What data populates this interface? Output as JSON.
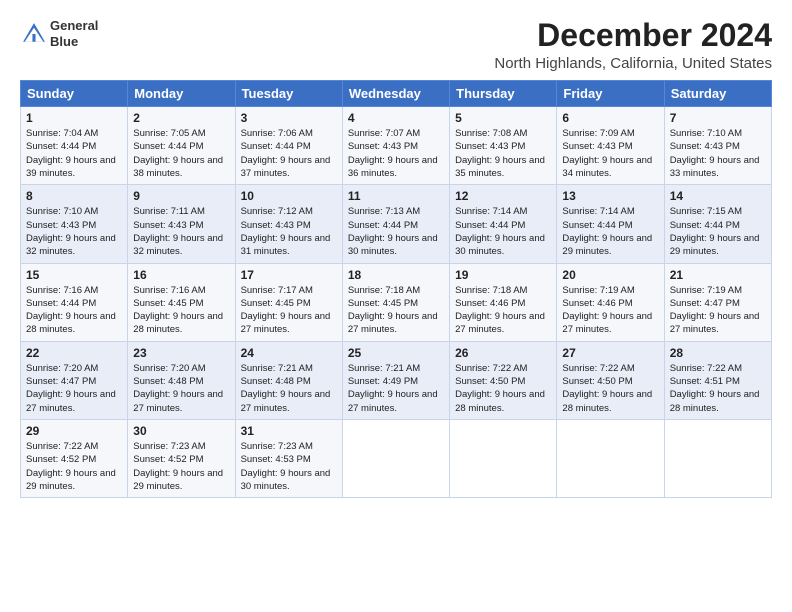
{
  "header": {
    "logo_line1": "General",
    "logo_line2": "Blue",
    "title": "December 2024",
    "location": "North Highlands, California, United States"
  },
  "days_of_week": [
    "Sunday",
    "Monday",
    "Tuesday",
    "Wednesday",
    "Thursday",
    "Friday",
    "Saturday"
  ],
  "weeks": [
    [
      {
        "day": "1",
        "sunrise": "Sunrise: 7:04 AM",
        "sunset": "Sunset: 4:44 PM",
        "daylight": "Daylight: 9 hours and 39 minutes."
      },
      {
        "day": "2",
        "sunrise": "Sunrise: 7:05 AM",
        "sunset": "Sunset: 4:44 PM",
        "daylight": "Daylight: 9 hours and 38 minutes."
      },
      {
        "day": "3",
        "sunrise": "Sunrise: 7:06 AM",
        "sunset": "Sunset: 4:44 PM",
        "daylight": "Daylight: 9 hours and 37 minutes."
      },
      {
        "day": "4",
        "sunrise": "Sunrise: 7:07 AM",
        "sunset": "Sunset: 4:43 PM",
        "daylight": "Daylight: 9 hours and 36 minutes."
      },
      {
        "day": "5",
        "sunrise": "Sunrise: 7:08 AM",
        "sunset": "Sunset: 4:43 PM",
        "daylight": "Daylight: 9 hours and 35 minutes."
      },
      {
        "day": "6",
        "sunrise": "Sunrise: 7:09 AM",
        "sunset": "Sunset: 4:43 PM",
        "daylight": "Daylight: 9 hours and 34 minutes."
      },
      {
        "day": "7",
        "sunrise": "Sunrise: 7:10 AM",
        "sunset": "Sunset: 4:43 PM",
        "daylight": "Daylight: 9 hours and 33 minutes."
      }
    ],
    [
      {
        "day": "8",
        "sunrise": "Sunrise: 7:10 AM",
        "sunset": "Sunset: 4:43 PM",
        "daylight": "Daylight: 9 hours and 32 minutes."
      },
      {
        "day": "9",
        "sunrise": "Sunrise: 7:11 AM",
        "sunset": "Sunset: 4:43 PM",
        "daylight": "Daylight: 9 hours and 32 minutes."
      },
      {
        "day": "10",
        "sunrise": "Sunrise: 7:12 AM",
        "sunset": "Sunset: 4:43 PM",
        "daylight": "Daylight: 9 hours and 31 minutes."
      },
      {
        "day": "11",
        "sunrise": "Sunrise: 7:13 AM",
        "sunset": "Sunset: 4:44 PM",
        "daylight": "Daylight: 9 hours and 30 minutes."
      },
      {
        "day": "12",
        "sunrise": "Sunrise: 7:14 AM",
        "sunset": "Sunset: 4:44 PM",
        "daylight": "Daylight: 9 hours and 30 minutes."
      },
      {
        "day": "13",
        "sunrise": "Sunrise: 7:14 AM",
        "sunset": "Sunset: 4:44 PM",
        "daylight": "Daylight: 9 hours and 29 minutes."
      },
      {
        "day": "14",
        "sunrise": "Sunrise: 7:15 AM",
        "sunset": "Sunset: 4:44 PM",
        "daylight": "Daylight: 9 hours and 29 minutes."
      }
    ],
    [
      {
        "day": "15",
        "sunrise": "Sunrise: 7:16 AM",
        "sunset": "Sunset: 4:44 PM",
        "daylight": "Daylight: 9 hours and 28 minutes."
      },
      {
        "day": "16",
        "sunrise": "Sunrise: 7:16 AM",
        "sunset": "Sunset: 4:45 PM",
        "daylight": "Daylight: 9 hours and 28 minutes."
      },
      {
        "day": "17",
        "sunrise": "Sunrise: 7:17 AM",
        "sunset": "Sunset: 4:45 PM",
        "daylight": "Daylight: 9 hours and 27 minutes."
      },
      {
        "day": "18",
        "sunrise": "Sunrise: 7:18 AM",
        "sunset": "Sunset: 4:45 PM",
        "daylight": "Daylight: 9 hours and 27 minutes."
      },
      {
        "day": "19",
        "sunrise": "Sunrise: 7:18 AM",
        "sunset": "Sunset: 4:46 PM",
        "daylight": "Daylight: 9 hours and 27 minutes."
      },
      {
        "day": "20",
        "sunrise": "Sunrise: 7:19 AM",
        "sunset": "Sunset: 4:46 PM",
        "daylight": "Daylight: 9 hours and 27 minutes."
      },
      {
        "day": "21",
        "sunrise": "Sunrise: 7:19 AM",
        "sunset": "Sunset: 4:47 PM",
        "daylight": "Daylight: 9 hours and 27 minutes."
      }
    ],
    [
      {
        "day": "22",
        "sunrise": "Sunrise: 7:20 AM",
        "sunset": "Sunset: 4:47 PM",
        "daylight": "Daylight: 9 hours and 27 minutes."
      },
      {
        "day": "23",
        "sunrise": "Sunrise: 7:20 AM",
        "sunset": "Sunset: 4:48 PM",
        "daylight": "Daylight: 9 hours and 27 minutes."
      },
      {
        "day": "24",
        "sunrise": "Sunrise: 7:21 AM",
        "sunset": "Sunset: 4:48 PM",
        "daylight": "Daylight: 9 hours and 27 minutes."
      },
      {
        "day": "25",
        "sunrise": "Sunrise: 7:21 AM",
        "sunset": "Sunset: 4:49 PM",
        "daylight": "Daylight: 9 hours and 27 minutes."
      },
      {
        "day": "26",
        "sunrise": "Sunrise: 7:22 AM",
        "sunset": "Sunset: 4:50 PM",
        "daylight": "Daylight: 9 hours and 28 minutes."
      },
      {
        "day": "27",
        "sunrise": "Sunrise: 7:22 AM",
        "sunset": "Sunset: 4:50 PM",
        "daylight": "Daylight: 9 hours and 28 minutes."
      },
      {
        "day": "28",
        "sunrise": "Sunrise: 7:22 AM",
        "sunset": "Sunset: 4:51 PM",
        "daylight": "Daylight: 9 hours and 28 minutes."
      }
    ],
    [
      {
        "day": "29",
        "sunrise": "Sunrise: 7:22 AM",
        "sunset": "Sunset: 4:52 PM",
        "daylight": "Daylight: 9 hours and 29 minutes."
      },
      {
        "day": "30",
        "sunrise": "Sunrise: 7:23 AM",
        "sunset": "Sunset: 4:52 PM",
        "daylight": "Daylight: 9 hours and 29 minutes."
      },
      {
        "day": "31",
        "sunrise": "Sunrise: 7:23 AM",
        "sunset": "Sunset: 4:53 PM",
        "daylight": "Daylight: 9 hours and 30 minutes."
      },
      null,
      null,
      null,
      null
    ]
  ]
}
